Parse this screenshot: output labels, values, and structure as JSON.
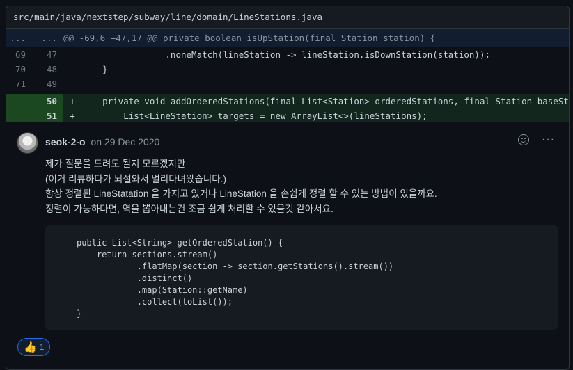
{
  "file": {
    "path": "src/main/java/nextstep/subway/line/domain/LineStations.java"
  },
  "diff": {
    "hunk": {
      "old": "...",
      "new": "...",
      "text": "@@ -69,6 +47,17 @@ private boolean isUpStation(final Station station) {"
    },
    "lines": [
      {
        "old": "69",
        "new": "47",
        "marker": "",
        "type": "context",
        "text": "                .noneMatch(lineStation -> lineStation.isDownStation(station));"
      },
      {
        "old": "70",
        "new": "48",
        "marker": "",
        "type": "context",
        "text": "    }"
      },
      {
        "old": "71",
        "new": "49",
        "marker": "",
        "type": "context",
        "text": ""
      },
      {
        "old": "",
        "new": "50",
        "marker": "+",
        "type": "add",
        "text": "    private void addOrderedStations(final List<Station> orderedStations, final Station baseStat"
      },
      {
        "old": "",
        "new": "51",
        "marker": "+",
        "type": "add",
        "text": "        List<LineStation> targets = new ArrayList<>(lineStations);"
      }
    ]
  },
  "comment": {
    "author": "seok-2-o",
    "date": "on 29 Dec 2020",
    "icons": [
      "smiley-icon",
      "kebab-menu-icon"
    ],
    "body": [
      "제가 질문을 드려도 될지 모르겠지만",
      "(이거 리뷰하다가 뇌절와서 멀리다녀왔습니다.)",
      "항상 정렬된 LineStatation 을 가지고 있거나 LineStation 을 손쉽게 정렬 할 수 있는 방법이 있을까요.",
      "정렬이 가능하다면, 역을 뽑아내는건 조금 쉽게 처리할 수 있을것 같아서요."
    ],
    "code": [
      "public List<String> getOrderedStation() {",
      "    return sections.stream()",
      "            .flatMap(section -> section.getStations().stream())",
      "            .distinct()",
      "            .map(Station::getName)",
      "            .collect(toList());",
      "}"
    ],
    "reaction": {
      "icon": "thumbs-up-icon",
      "count": "1"
    }
  }
}
